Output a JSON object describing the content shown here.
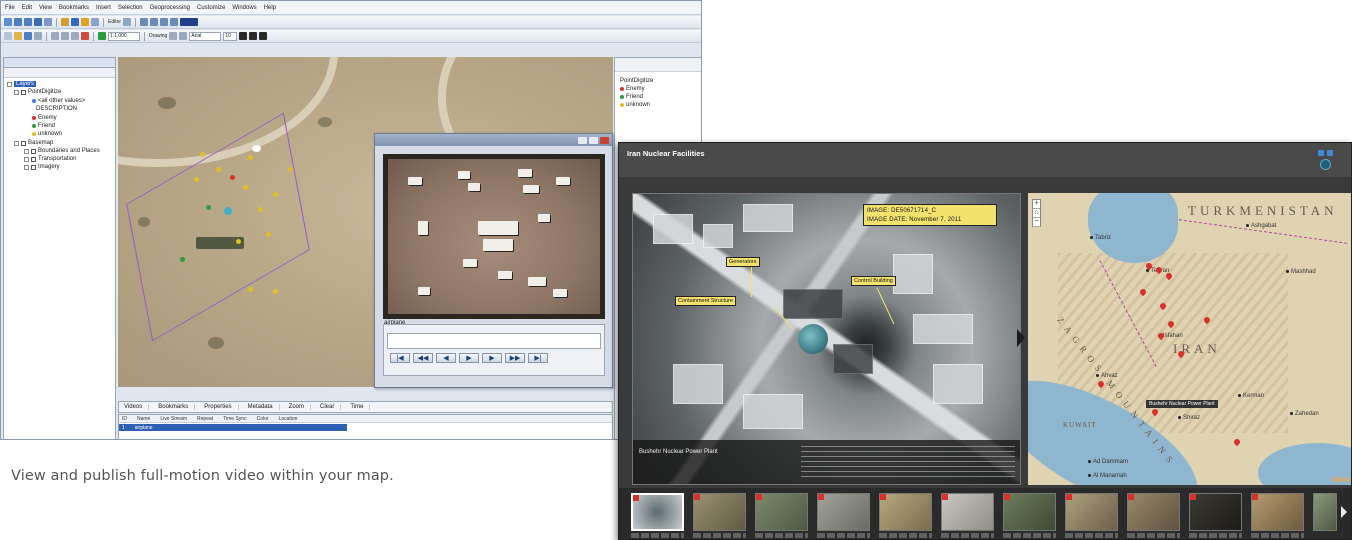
{
  "arcmap": {
    "menu": [
      "File",
      "Edit",
      "View",
      "Bookmarks",
      "Insert",
      "Selection",
      "Geoprocessing",
      "Customize",
      "Windows",
      "Help"
    ],
    "toolbar": {
      "scale_value": "1:1,000",
      "editor_label": "Editor",
      "drawing_label": "Drawing",
      "font_value": "Arial",
      "font_size": "10"
    },
    "toc": {
      "root": "Layers",
      "group1": "PointDigitize",
      "heading": "<all other values>",
      "field": "DESCRIPTION",
      "items": [
        "Enemy",
        "Friend",
        "unknown"
      ],
      "group2": "Basemap",
      "basemap_items": [
        "Boundaries and Places",
        "Transportation",
        "Imagery"
      ]
    },
    "right_panel": {
      "group": "PointDigitize",
      "items": [
        "Enemy",
        "Friend",
        "unknown"
      ]
    },
    "video": {
      "layer_name": "airplane"
    },
    "bottom_tabs": [
      "Videos",
      "Bookmarks",
      "Properties",
      "Metadata",
      "Zoom",
      "Clear",
      "Time"
    ],
    "bottom_grid": {
      "columns": [
        "ID",
        "Name",
        "Live Stream",
        "Repeat",
        "Time Sync",
        "Color",
        "Location"
      ],
      "row": [
        "1",
        "airplane",
        "",
        "",
        "",
        "",
        ""
      ]
    }
  },
  "caption": "View and publish full-motion video within your map.",
  "story": {
    "title": "Iran Nuclear Facilities",
    "subtitle": "",
    "image": {
      "info_line1": "IMAGE: DE50671714_C",
      "info_line2": "IMAGE DATE: November 7, 2011",
      "labels": {
        "generators": "Generators",
        "containment": "Containment Structure",
        "control": "Control Building"
      },
      "caption_name": "Bushehr Nuclear Power Plant"
    },
    "map": {
      "countries": {
        "turkmenistan": "TURKMENISTAN",
        "iran": "IRAN",
        "kuwait": "KUWAIT"
      },
      "ranges": {
        "zagros": "ZAGROS MOUNTAINS"
      },
      "cities": {
        "tabriz": "Tabriz",
        "ashgabat": "Ashgabat",
        "tehran": "Tehran",
        "mashhad": "Mashhad",
        "isfahan": "Isfahan",
        "ahvaz": "Ahvaz",
        "kerman": "Kerman",
        "shiraz": "Shiraz",
        "zahedan": "Zahedan",
        "ad_dammam": "Ad Dammam",
        "al_manamah": "Al Manamah"
      },
      "popup": "Bushehr Nuclear Power Plant"
    }
  }
}
